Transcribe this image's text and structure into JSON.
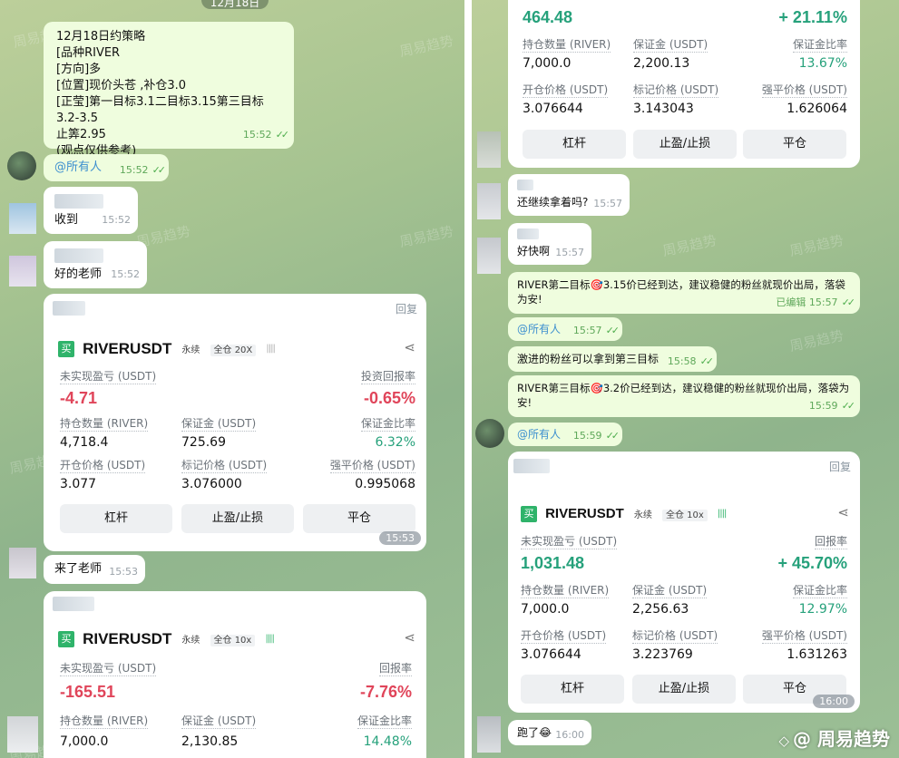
{
  "left": {
    "date_chip": "12月18日",
    "watermark": "周易趋势",
    "strategy": {
      "lines": [
        "12月18日约策略",
        "[品种RIVER",
        "[方向]多",
        "[位置]现价头苍 ,补仓3.0",
        "[正莹]第一目标3.1二目标3.15第三目标3.2-3.5",
        "止筭2.95",
        "(观点仅供参考)"
      ],
      "time": "15:52"
    },
    "mention": {
      "text": "@所有人",
      "time": "15:52"
    },
    "msg_received": {
      "text": "收到",
      "time": "15:52"
    },
    "msg_ok": {
      "text": "好的老师",
      "time": "15:52"
    },
    "card1": {
      "reply": "回复",
      "buy": "买",
      "symbol": "RIVERUSDT",
      "perp": "永续",
      "margin": "全仓 20X",
      "bars": "||||",
      "pnl_label": "未实现盈亏 (USDT)",
      "pnl": "-4.71",
      "roi_label": "投资回报率",
      "roi": "-0.65%",
      "qty_label": "持仓数量 (RIVER)",
      "qty": "4,718.4",
      "margin_label": "保证金 (USDT)",
      "margin_val": "725.69",
      "ratio_label": "保证金比率",
      "ratio": "6.32%",
      "open_label": "开仓价格 (USDT)",
      "open": "3.077",
      "mark_label": "标记价格 (USDT)",
      "mark": "3.076000",
      "liq_label": "强平价格 (USDT)",
      "liq": "0.995068",
      "btn_lev": "杠杆",
      "btn_tpsl": "止盈/止损",
      "btn_close": "平仓",
      "stamp": "15:53"
    },
    "msg_came": {
      "text": "来了老师",
      "time": "15:53"
    },
    "card2": {
      "buy": "买",
      "symbol": "RIVERUSDT",
      "perp": "永续",
      "margin": "全仓 10x",
      "bars": "||||",
      "pnl_label": "未实现盈亏 (USDT)",
      "pnl": "-165.51",
      "roi_label": "回报率",
      "roi": "-7.76%",
      "qty_label": "持仓数量 (RIVER)",
      "qty": "7,000.0",
      "margin_label": "保证金 (USDT)",
      "margin_val": "2,130.85",
      "ratio_label": "保证金比率",
      "ratio": "14.48%"
    }
  },
  "right": {
    "watermark": "周易趋势",
    "card_top": {
      "pnl": "464.48",
      "roi": "+ 21.11%",
      "qty_label": "持仓数量 (RIVER)",
      "qty": "7,000.0",
      "margin_label": "保证金 (USDT)",
      "margin_val": "2,200.13",
      "ratio_label": "保证金比率",
      "ratio": "13.67%",
      "open_label": "开仓价格 (USDT)",
      "open": "3.076644",
      "mark_label": "标记价格 (USDT)",
      "mark": "3.143043",
      "liq_label": "强平价格 (USDT)",
      "liq": "1.626064",
      "btn_lev": "杠杆",
      "btn_tpsl": "止盈/止损",
      "btn_close": "平仓"
    },
    "msg_hold": {
      "text": "还继续拿着吗?",
      "time": "15:57"
    },
    "msg_fast": {
      "text": "好快啊",
      "time": "15:57"
    },
    "msg_target2": {
      "text": "RIVER第二目标🎯3.15价已经到达，建议稳健的粉丝就现价出局，落袋为安!",
      "edited": "已编辑",
      "time": "15:57"
    },
    "mention2": {
      "text": "@所有人",
      "time": "15:57"
    },
    "msg_aggr": {
      "text": "激进的粉丝可以拿到第三目标",
      "time": "15:58"
    },
    "msg_target3": {
      "text": "RIVER第三目标🎯3.2价已经到达，建议稳健的粉丝就现价出局，落袋为安!",
      "time": "15:59"
    },
    "mention3": {
      "text": "@所有人",
      "time": "15:59"
    },
    "card_bottom": {
      "reply": "回复",
      "buy": "买",
      "symbol": "RIVERUSDT",
      "perp": "永续",
      "margin": "全仓 10x",
      "bars": "||||",
      "pnl_label": "未实现盈亏 (USDT)",
      "pnl": "1,031.48",
      "roi_label": "回报率",
      "roi": "+ 45.70%",
      "qty_label": "持仓数量 (RIVER)",
      "qty": "7,000.0",
      "margin_label": "保证金 (USDT)",
      "margin_val": "2,256.63",
      "ratio_label": "保证金比率",
      "ratio": "12.97%",
      "open_label": "开仓价格 (USDT)",
      "open": "3.076644",
      "mark_label": "标记价格 (USDT)",
      "mark": "3.223769",
      "liq_label": "强平价格 (USDT)",
      "liq": "1.631263",
      "btn_lev": "杠杆",
      "btn_tpsl": "止盈/止损",
      "btn_close": "平仓",
      "stamp": "16:00"
    },
    "msg_ran": {
      "text": "跑了😂",
      "time": "16:00"
    },
    "footer_brand": "@ 周易趋势"
  },
  "colors": {
    "green_time": "#5fa85a",
    "negative": "#e0455a",
    "positive": "#26a17b",
    "bubble_out": "#effdde"
  }
}
